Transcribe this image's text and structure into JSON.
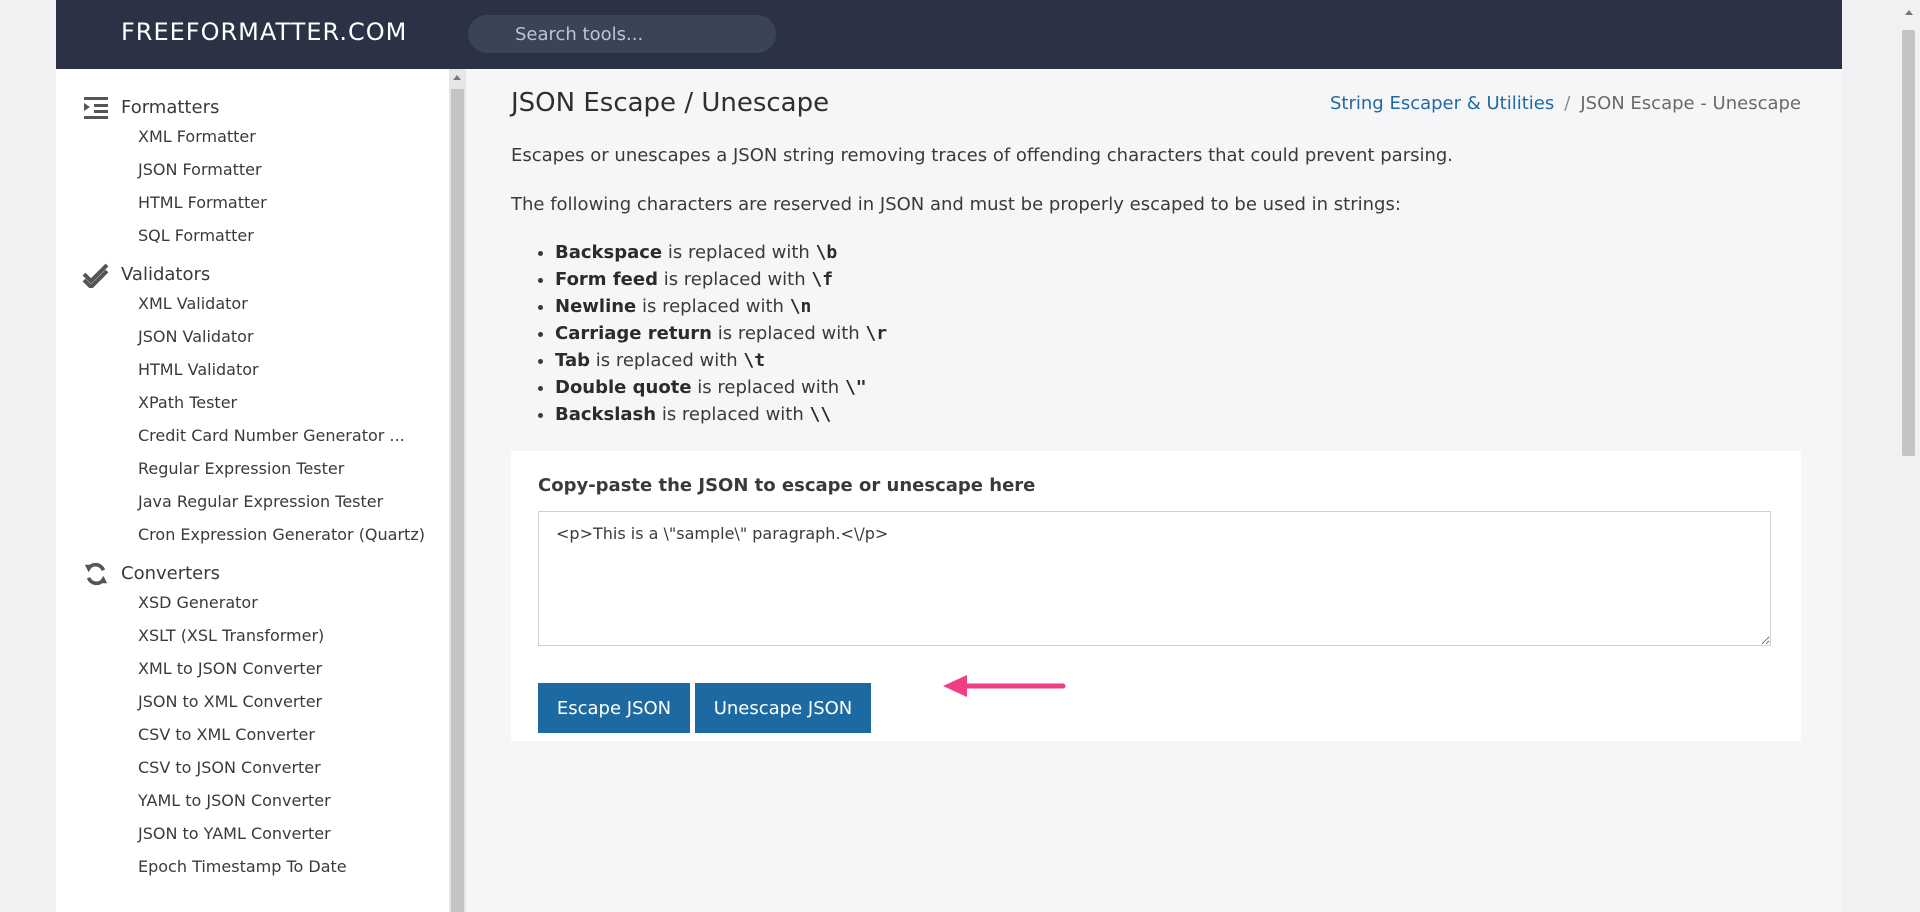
{
  "header": {
    "logo": "FREEFORMATTER.COM",
    "search_placeholder": "Search tools..."
  },
  "sidebar": {
    "sections": [
      {
        "title": "Formatters",
        "icon": "indent-list-icon",
        "items": [
          "XML Formatter",
          "JSON Formatter",
          "HTML Formatter",
          "SQL Formatter"
        ]
      },
      {
        "title": "Validators",
        "icon": "double-check-icon",
        "items": [
          "XML Validator",
          "JSON Validator",
          "HTML Validator",
          "XPath Tester",
          "Credit Card Number Generator ...",
          "Regular Expression Tester",
          "Java Regular Expression Tester",
          "Cron Expression Generator (Quartz)"
        ]
      },
      {
        "title": "Converters",
        "icon": "refresh-icon",
        "items": [
          "XSD Generator",
          "XSLT (XSL Transformer)",
          "XML to JSON Converter",
          "JSON to XML Converter",
          "CSV to XML Converter",
          "CSV to JSON Converter",
          "YAML to JSON Converter",
          "JSON to YAML Converter",
          "Epoch Timestamp To Date"
        ]
      }
    ]
  },
  "main": {
    "title": "JSON Escape / Unescape",
    "breadcrumb": {
      "parent": "String Escaper & Utilities",
      "separator": "/",
      "current": "JSON Escape - Unescape"
    },
    "intro": "Escapes or unescapes a JSON string removing traces of offending characters that could prevent parsing.",
    "reserved_intro": "The following characters are reserved in JSON and must be properly escaped to be used in strings:",
    "reserved": [
      {
        "name": "Backspace",
        "text": "is replaced with",
        "code": "\\b"
      },
      {
        "name": "Form feed",
        "text": "is replaced with",
        "code": "\\f"
      },
      {
        "name": "Newline",
        "text": "is replaced with",
        "code": "\\n"
      },
      {
        "name": "Carriage return",
        "text": "is replaced with",
        "code": "\\r"
      },
      {
        "name": "Tab",
        "text": "is replaced with",
        "code": "\\t"
      },
      {
        "name": "Double quote",
        "text": "is replaced with",
        "code": "\\\""
      },
      {
        "name": "Backslash",
        "text": "is replaced with",
        "code": "\\\\"
      }
    ],
    "form": {
      "label": "Copy-paste the JSON to escape or unescape here",
      "input_value": "<p>This is a \\\"sample\\\" paragraph.<\\/p>",
      "escape_button": "Escape JSON",
      "unescape_button": "Unescape JSON"
    }
  },
  "colors": {
    "topbar": "#2b3245",
    "button": "#1d6aa3",
    "link": "#1f6aa4",
    "arrow": "#ee3f86"
  }
}
